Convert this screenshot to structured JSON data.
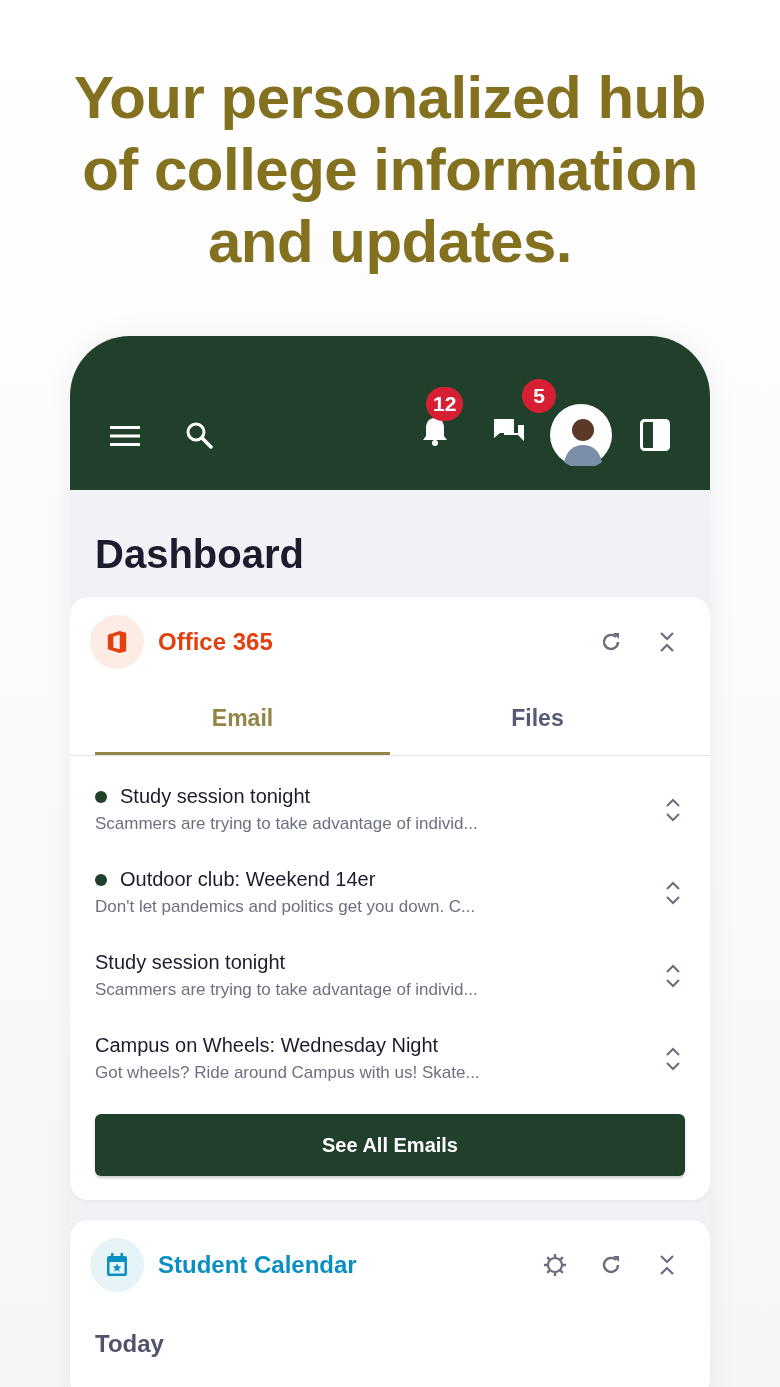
{
  "headline": "Your personalized hub of college information and updates.",
  "header": {
    "notifications_badge": "12",
    "messages_badge": "5"
  },
  "page_title": "Dashboard",
  "office_card": {
    "title": "Office 365",
    "tabs": [
      {
        "label": "Email",
        "selected": true
      },
      {
        "label": "Files",
        "selected": false
      }
    ],
    "emails": [
      {
        "subject": "Study session tonight",
        "preview": "Scammers are trying to take advantage of individ...",
        "unread": true
      },
      {
        "subject": "Outdoor club: Weekend 14er",
        "preview": "Don't let pandemics and politics get you down. C...",
        "unread": true
      },
      {
        "subject": "Study session tonight",
        "preview": "Scammers are trying to take advantage of individ...",
        "unread": false
      },
      {
        "subject": "Campus on Wheels: Wednesday Night",
        "preview": "Got wheels? Ride around Campus with us! Skate...",
        "unread": false
      }
    ],
    "button": "See All Emails"
  },
  "calendar_card": {
    "title": "Student Calendar",
    "section": "Today"
  }
}
